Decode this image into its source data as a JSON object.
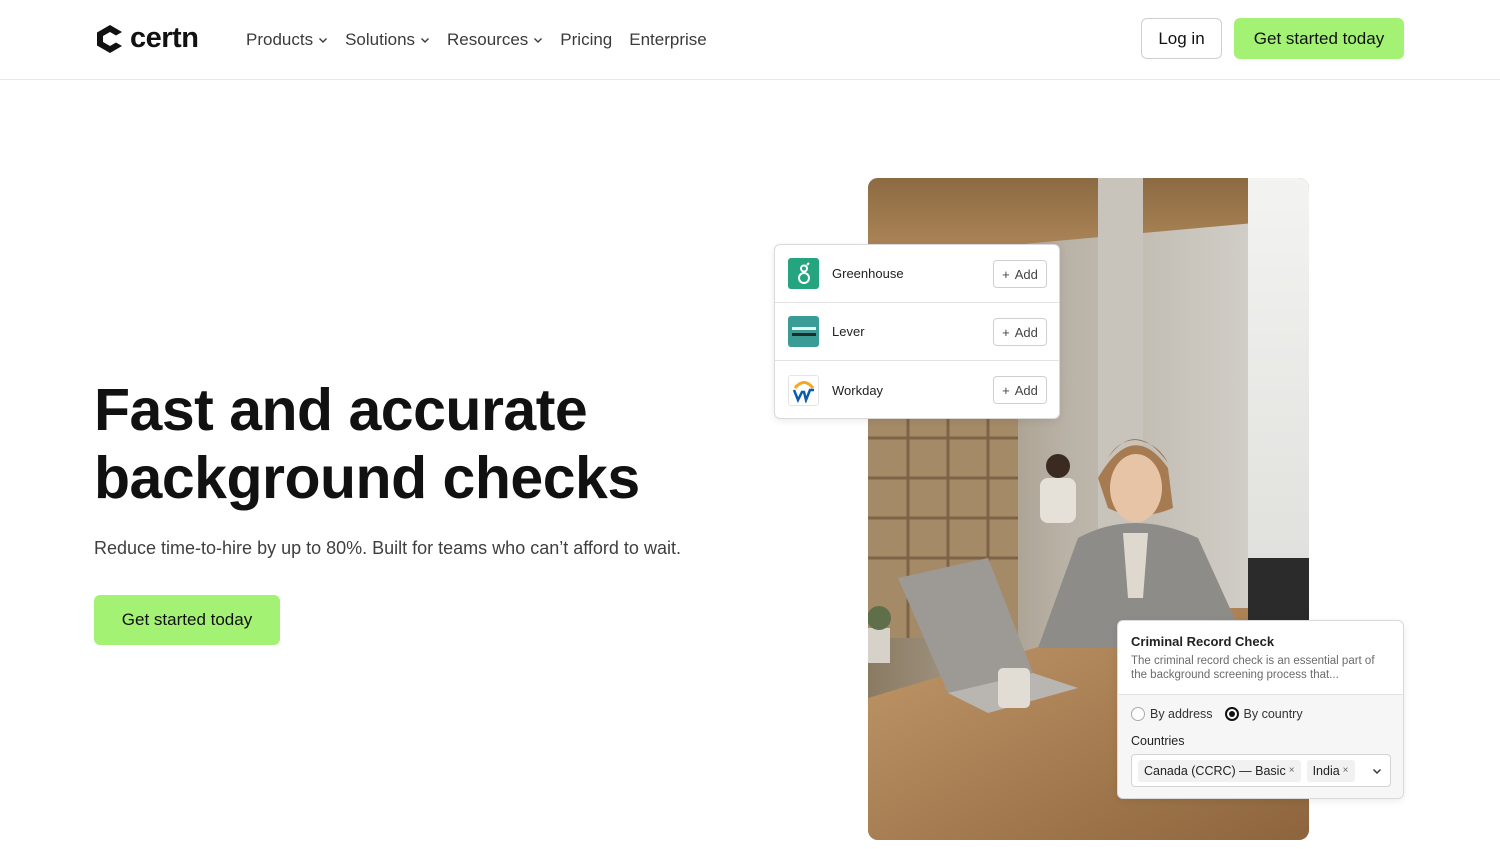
{
  "brand": {
    "name": "certn",
    "accent": "#a3f273"
  },
  "nav": {
    "items": [
      {
        "label": "Products",
        "dropdown": true
      },
      {
        "label": "Solutions",
        "dropdown": true
      },
      {
        "label": "Resources",
        "dropdown": true
      },
      {
        "label": "Pricing",
        "dropdown": false
      },
      {
        "label": "Enterprise",
        "dropdown": false
      }
    ],
    "login_label": "Log in",
    "cta_label": "Get started today"
  },
  "hero": {
    "headline_line1": "Fast and accurate",
    "headline_line2": "background checks",
    "subhead": "Reduce time-to-hire by up to 80%. Built for teams who can’t afford to wait.",
    "cta_label": "Get started today"
  },
  "integrations": [
    {
      "name": "Greenhouse",
      "add_label": "Add",
      "icon": "greenhouse-logo"
    },
    {
      "name": "Lever",
      "add_label": "Add",
      "icon": "lever-logo"
    },
    {
      "name": "Workday",
      "add_label": "Add",
      "icon": "workday-logo"
    }
  ],
  "criminal_check": {
    "title": "Criminal Record Check",
    "description": "The criminal record check is an essential part of the background screening process that...",
    "options": [
      {
        "label": "By address",
        "selected": false
      },
      {
        "label": "By country",
        "selected": true
      }
    ],
    "countries_label": "Countries",
    "selected_countries": [
      "Canada (CCRC) — Basic",
      "India"
    ]
  }
}
